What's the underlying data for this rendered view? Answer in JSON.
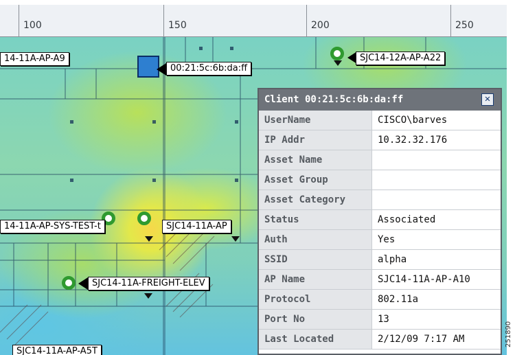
{
  "ruler": {
    "marks": [
      "100",
      "150",
      "200",
      "250"
    ]
  },
  "map": {
    "access_points": {
      "a9": "14-11A-AP-A9",
      "a22": "SJC14-12A-AP-A22",
      "sys_test": "14-11A-AP-SYS-TEST-t",
      "a_trunc": "SJC14-11A-AP",
      "freight": "SJC14-11A-FREIGHT-ELEV",
      "a5t": "SJC14-11A-AP-A5T"
    },
    "client_label": "00:21:5c:6b:da:ff",
    "colors": {
      "ap_ring": "#2f9a2f",
      "client_marker": "#2e7fd0"
    }
  },
  "panel": {
    "title": "Client 00:21:5c:6b:da:ff",
    "rows": [
      {
        "key": "UserName",
        "value": "CISCO\\barves"
      },
      {
        "key": "IP Addr",
        "value": "10.32.32.176"
      },
      {
        "key": "Asset Name",
        "value": ""
      },
      {
        "key": "Asset Group",
        "value": ""
      },
      {
        "key": "Asset Category",
        "value": ""
      },
      {
        "key": "Status",
        "value": "Associated"
      },
      {
        "key": "Auth",
        "value": "Yes"
      },
      {
        "key": "SSID",
        "value": "alpha"
      },
      {
        "key": "AP Name",
        "value": "SJC14-11A-AP-A10"
      },
      {
        "key": "Protocol",
        "value": "802.11a"
      },
      {
        "key": "Port No",
        "value": "13"
      },
      {
        "key": "Last Located",
        "value": "2/12/09 7:17 AM"
      }
    ]
  },
  "figure_id": "251890"
}
